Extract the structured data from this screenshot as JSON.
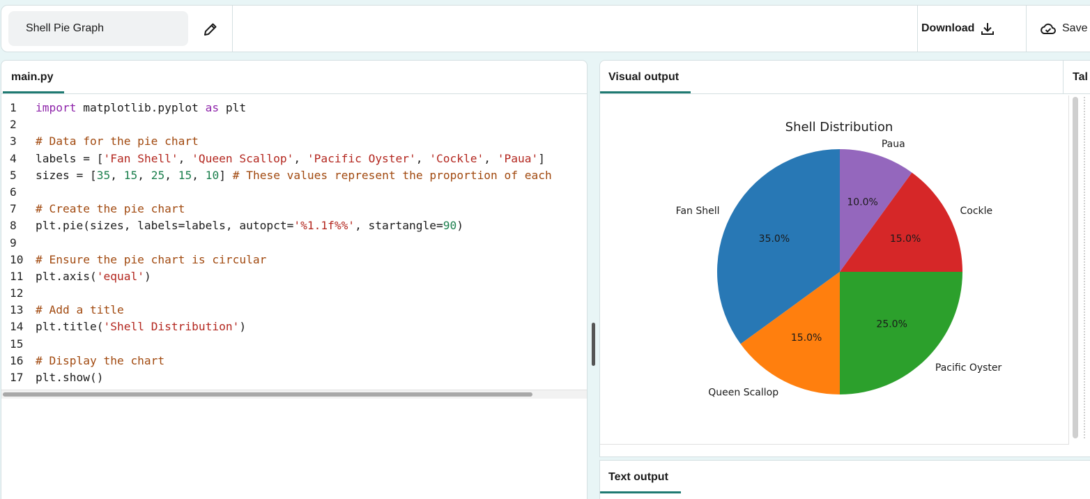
{
  "header": {
    "project_name": "Shell Pie Graph",
    "download_label": "Download",
    "save_label": "Save"
  },
  "editor": {
    "tab_label": "main.py",
    "lines": [
      {
        "n": "1",
        "tokens": [
          {
            "t": "import",
            "c": "kw"
          },
          {
            "t": " matplotlib.pyplot ",
            "c": ""
          },
          {
            "t": "as",
            "c": "kw"
          },
          {
            "t": " plt",
            "c": ""
          }
        ]
      },
      {
        "n": "2",
        "tokens": []
      },
      {
        "n": "3",
        "tokens": [
          {
            "t": "# Data for the pie chart",
            "c": "cmt"
          }
        ]
      },
      {
        "n": "4",
        "tokens": [
          {
            "t": "labels = [",
            "c": ""
          },
          {
            "t": "'Fan Shell'",
            "c": "str"
          },
          {
            "t": ", ",
            "c": ""
          },
          {
            "t": "'Queen Scallop'",
            "c": "str"
          },
          {
            "t": ", ",
            "c": ""
          },
          {
            "t": "'Pacific Oyster'",
            "c": "str"
          },
          {
            "t": ", ",
            "c": ""
          },
          {
            "t": "'Cockle'",
            "c": "str"
          },
          {
            "t": ", ",
            "c": ""
          },
          {
            "t": "'Paua'",
            "c": "str"
          },
          {
            "t": "]",
            "c": ""
          }
        ]
      },
      {
        "n": "5",
        "tokens": [
          {
            "t": "sizes = [",
            "c": ""
          },
          {
            "t": "35",
            "c": "num"
          },
          {
            "t": ", ",
            "c": ""
          },
          {
            "t": "15",
            "c": "num"
          },
          {
            "t": ", ",
            "c": ""
          },
          {
            "t": "25",
            "c": "num"
          },
          {
            "t": ", ",
            "c": ""
          },
          {
            "t": "15",
            "c": "num"
          },
          {
            "t": ", ",
            "c": ""
          },
          {
            "t": "10",
            "c": "num"
          },
          {
            "t": "] ",
            "c": ""
          },
          {
            "t": "# These values represent the proportion of each",
            "c": "cmt"
          }
        ]
      },
      {
        "n": "6",
        "tokens": []
      },
      {
        "n": "7",
        "tokens": [
          {
            "t": "# Create the pie chart",
            "c": "cmt"
          }
        ]
      },
      {
        "n": "8",
        "tokens": [
          {
            "t": "plt.pie(sizes, labels=labels, autopct=",
            "c": ""
          },
          {
            "t": "'%1.1f%%'",
            "c": "str"
          },
          {
            "t": ", startangle=",
            "c": ""
          },
          {
            "t": "90",
            "c": "num"
          },
          {
            "t": ")",
            "c": ""
          }
        ]
      },
      {
        "n": "9",
        "tokens": []
      },
      {
        "n": "10",
        "tokens": [
          {
            "t": "# Ensure the pie chart is circular",
            "c": "cmt"
          }
        ]
      },
      {
        "n": "11",
        "tokens": [
          {
            "t": "plt.axis(",
            "c": ""
          },
          {
            "t": "'equal'",
            "c": "str"
          },
          {
            "t": ")",
            "c": ""
          }
        ]
      },
      {
        "n": "12",
        "tokens": []
      },
      {
        "n": "13",
        "tokens": [
          {
            "t": "# Add a title",
            "c": "cmt"
          }
        ]
      },
      {
        "n": "14",
        "tokens": [
          {
            "t": "plt.title(",
            "c": ""
          },
          {
            "t": "'Shell Distribution'",
            "c": "str"
          },
          {
            "t": ")",
            "c": ""
          }
        ]
      },
      {
        "n": "15",
        "tokens": []
      },
      {
        "n": "16",
        "tokens": [
          {
            "t": "# Display the chart",
            "c": "cmt"
          }
        ]
      },
      {
        "n": "17",
        "tokens": [
          {
            "t": "plt.show()",
            "c": ""
          }
        ]
      }
    ]
  },
  "output": {
    "visual_tab_label": "Visual output",
    "table_tab_label": "Tal",
    "text_tab_label": "Text output"
  },
  "colors": {
    "accent": "#1f7a72",
    "blue": "#2878b5",
    "orange": "#ff7f0e",
    "green": "#2ca02c",
    "red": "#d62728",
    "purple": "#9467bd"
  },
  "chart_data": {
    "type": "pie",
    "title": "Shell Distribution",
    "startangle": 90,
    "counterclock": true,
    "slices": [
      {
        "label": "Fan Shell",
        "value": 35,
        "pct_label": "35.0%",
        "color": "#2878b5"
      },
      {
        "label": "Queen Scallop",
        "value": 15,
        "pct_label": "15.0%",
        "color": "#ff7f0e"
      },
      {
        "label": "Pacific Oyster",
        "value": 25,
        "pct_label": "25.0%",
        "color": "#2ca02c"
      },
      {
        "label": "Cockle",
        "value": 15,
        "pct_label": "15.0%",
        "color": "#d62728"
      },
      {
        "label": "Paua",
        "value": 10,
        "pct_label": "10.0%",
        "color": "#9467bd"
      }
    ]
  }
}
